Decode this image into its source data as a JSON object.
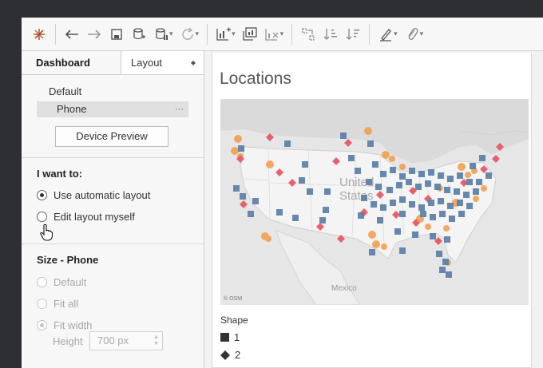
{
  "sidebar": {
    "tabs": [
      {
        "label": "Dashboard"
      },
      {
        "label": "Layout"
      }
    ],
    "devices": {
      "default_label": "Default",
      "selected_label": "Phone",
      "more_label": "···",
      "preview_button": "Device Preview"
    },
    "layout_options": {
      "title": "I want to:",
      "option_auto": "Use automatic layout",
      "option_edit": "Edit layout myself",
      "selected": "Use automatic layout"
    },
    "size": {
      "title": "Size - Phone",
      "option_default": "Default",
      "option_fit_all": "Fit all",
      "option_fit_width": "Fit width",
      "height_label": "Height",
      "height_value": "700 px"
    }
  },
  "dashboard": {
    "title": "Locations",
    "map": {
      "country_label_line1": "United",
      "country_label_line2": "States",
      "neighbor_label": "Mexico",
      "attribution": "© OSM",
      "colors": {
        "shape1": "#5b7fa8",
        "shape2": "#e8616a",
        "orange": "#f2a050"
      }
    },
    "legend": {
      "title": "Shape",
      "items": [
        {
          "label": "1",
          "shape": "square"
        },
        {
          "label": "2",
          "shape": "diamond"
        }
      ]
    }
  }
}
